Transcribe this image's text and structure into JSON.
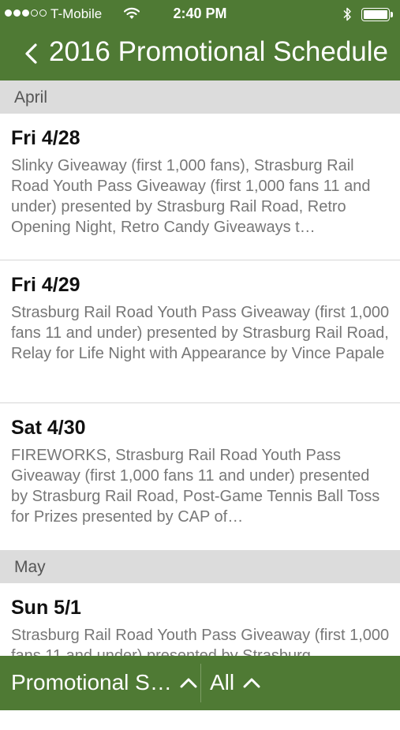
{
  "status_bar": {
    "carrier": "T-Mobile",
    "time": "2:40 PM",
    "signal_bars_filled": 3,
    "signal_bars_total": 5,
    "battery_level": 1.0
  },
  "nav": {
    "title": "2016 Promotional Schedule",
    "back_icon": "chevron-left-icon"
  },
  "sections": [
    {
      "name": "April",
      "items": [
        {
          "date": "Fri 4/28",
          "description": "Slinky Giveaway (first 1,000 fans), Strasburg Rail Road Youth Pass Giveaway (first 1,000 fans 11 and under) presented by Strasburg Rail Road, Retro Opening Night, Retro Candy Giveaways t…"
        },
        {
          "date": "Fri 4/29",
          "description": "Strasburg Rail Road Youth Pass Giveaway (first 1,000 fans 11 and under) presented by Strasburg Rail Road, Relay for Life Night with Appearance by Vince Papale"
        },
        {
          "date": "Sat 4/30",
          "description": "FIREWORKS, Strasburg Rail Road Youth Pass Giveaway (first 1,000 fans 11 and under) presented by Strasburg Rail Road, Post-Game Tennis Ball Toss for Prizes presented by CAP of…"
        }
      ]
    },
    {
      "name": "May",
      "items": [
        {
          "date": "Sun 5/1",
          "description": "Strasburg Rail Road Youth Pass Giveaway (first 1,000 fans 11 and under) presented by Strasburg"
        }
      ]
    }
  ],
  "footer": {
    "filter_left": "Promotional S…",
    "filter_right": "All",
    "icons": [
      "chevron-up-icon",
      "chevron-up-icon"
    ]
  },
  "colors": {
    "brand_green": "#4f7a34",
    "section_header_bg": "#dcdcdc",
    "description_gray": "#777777"
  }
}
